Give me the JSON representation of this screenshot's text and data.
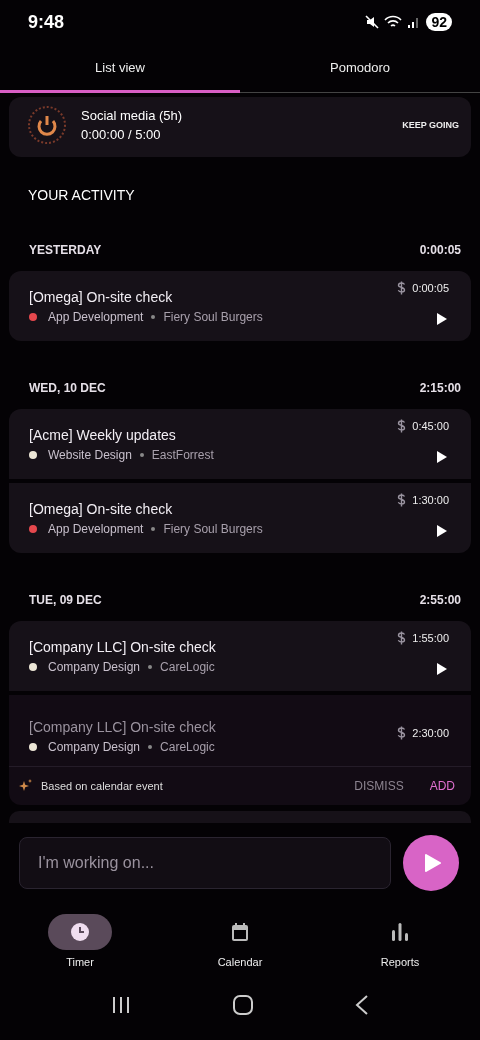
{
  "status_bar": {
    "time": "9:48",
    "battery": "92"
  },
  "tabs": [
    {
      "label": "List view",
      "selected": true
    },
    {
      "label": "Pomodoro",
      "selected": false
    }
  ],
  "goal": {
    "title": "Social media (5h)",
    "progress": "0:00:00 / 5:00",
    "action": "KEEP GOING"
  },
  "section_title": "YOUR ACTIVITY",
  "days": [
    {
      "label": "YESTERDAY",
      "total": "0:00:05",
      "entries": [
        {
          "kind": "entry",
          "title": "[Omega] On-site check",
          "project": "App Development",
          "color": "#e5484d",
          "client": "Fiery Soul Burgers",
          "duration": "0:00:05"
        }
      ]
    },
    {
      "label": "WED, 10 DEC",
      "total": "2:15:00",
      "entries": [
        {
          "kind": "entry",
          "title": "[Acme] Weekly updates",
          "project": "Website Design",
          "color": "#ece6d6",
          "client": "EastForrest",
          "duration": "0:45:00"
        },
        {
          "kind": "entry",
          "title": "[Omega] On-site check",
          "project": "App Development",
          "color": "#e5484d",
          "client": "Fiery Soul Burgers",
          "duration": "1:30:00"
        }
      ]
    },
    {
      "label": "TUE, 09 DEC",
      "total": "2:55:00",
      "entries": [
        {
          "kind": "entry",
          "title": "[Company LLC] On-site check",
          "project": "Company Design",
          "color": "#ece6d6",
          "client": "CareLogic",
          "duration": "1:55:00"
        },
        {
          "kind": "suggestion",
          "title": "[Company LLC] On-site check",
          "project": "Company Design",
          "color": "#ece6d6",
          "client": "CareLogic",
          "duration": "2:30:00",
          "note": "Based on calendar event",
          "dismiss": "DISMISS",
          "add": "ADD"
        }
      ]
    }
  ],
  "input": {
    "placeholder": "I'm working on..."
  },
  "nav": [
    {
      "label": "Timer",
      "selected": true
    },
    {
      "label": "Calendar",
      "selected": false
    },
    {
      "label": "Reports",
      "selected": false
    }
  ]
}
